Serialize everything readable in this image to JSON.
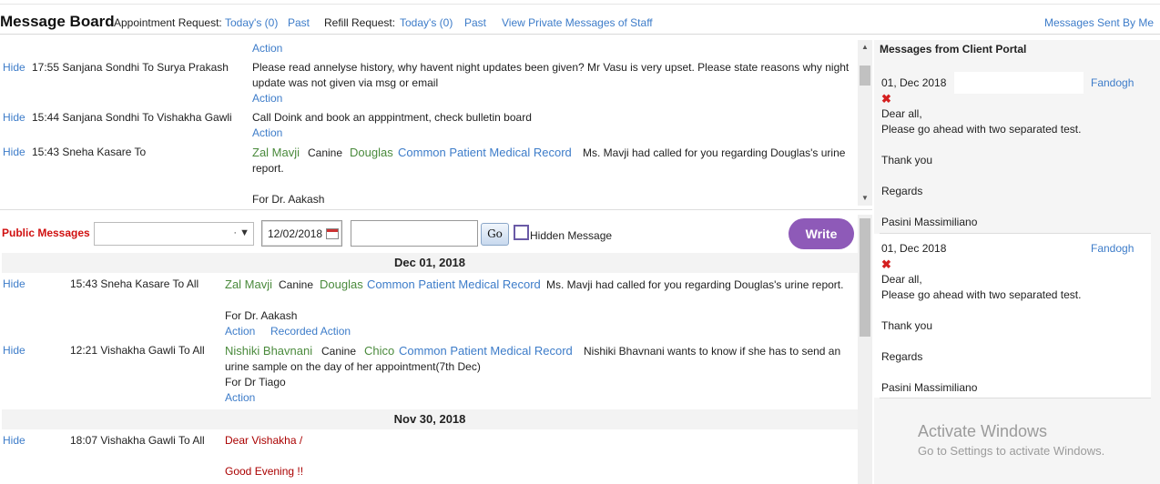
{
  "header": {
    "title": "Message Board",
    "appt_label": "Appointment Request:",
    "appt_today": "Today's (0)",
    "appt_past": "Past",
    "refill_label": "Refill Request:",
    "refill_today": "Today's (0)",
    "refill_past": "Past",
    "view_private": "View Private Messages of Staff",
    "sent_by_me": "Messages Sent By Me"
  },
  "private": {
    "top_action": "Action",
    "rows": [
      {
        "hide": "Hide",
        "meta": "17:55 Sanjana Sondhi To Surya Prakash",
        "line1": "Please read annelyse history, why havent night updates been given? Mr Vasu is very upset. Please state reasons why night",
        "line2": "update was not given via msg or email",
        "action": "Action"
      },
      {
        "hide": "Hide",
        "meta": "15:44 Sanjana Sondhi To Vishakha Gawli",
        "line1": "Call Doink and book an apppintment, check bulletin board",
        "action": "Action"
      },
      {
        "hide": "Hide",
        "meta": "15:43 Sneha Kasare To",
        "client": "Zal Mavji",
        "species": "Canine",
        "patient": "Douglas",
        "record": "Common Patient Medical Record",
        "line1": "Ms. Mavji had called for you regarding Douglas's urine",
        "line2": "report.",
        "line3": "For Dr. Aakash"
      }
    ]
  },
  "public_bar": {
    "label": "Public Messages",
    "select_value": "",
    "date_value": "12/02/2018",
    "search_value": "",
    "go": "Go",
    "hidden_label": "Hidden Message",
    "write": "Write"
  },
  "public": {
    "groups": [
      {
        "date": "Dec 01, 2018",
        "rows": [
          {
            "hide": "Hide",
            "meta": "15:43 Sneha Kasare To All",
            "client": "Zal Mavji",
            "species": "Canine",
            "patient": "Douglas",
            "record": "Common Patient Medical Record",
            "line1": "Ms. Mavji had called for you regarding Douglas's urine report.",
            "line3": "For Dr. Aakash",
            "action": "Action",
            "recorded": "Recorded Action"
          },
          {
            "hide": "Hide",
            "meta": "12:21 Vishakha Gawli To All",
            "client": "Nishiki Bhavnani",
            "species": "Canine",
            "patient": "Chico",
            "record": "Common Patient Medical Record",
            "line1": "Nishiki Bhavnani wants to know if she has to send an",
            "line2": "urine sample on the day of her appointment(7th Dec)",
            "line3": "For Dr Tiago",
            "action": "Action"
          }
        ]
      },
      {
        "date": "Nov 30, 2018",
        "rows": [
          {
            "hide": "Hide",
            "meta": "18:07 Vishakha Gawli To All",
            "line1": "Dear Vishakha /",
            "line2": "Good Evening !!"
          }
        ]
      }
    ]
  },
  "portal": {
    "title": "Messages from Client Portal",
    "cards": [
      {
        "date": "01, Dec 2018",
        "from": "Fandogh",
        "delete": "✖",
        "lines": [
          "Dear all,",
          "Please go ahead with two separated test.",
          "",
          "Thank you",
          "",
          "Regards",
          "",
          "Pasini Massimiliano"
        ]
      },
      {
        "date": "01, Dec 2018",
        "from": "Fandogh",
        "delete": "✖",
        "lines": [
          "Dear all,",
          "Please go ahead with two separated test.",
          "",
          "Thank you",
          "",
          "Regards",
          "",
          "Pasini Massimiliano"
        ]
      }
    ]
  },
  "os_notice": {
    "line1": "Activate Windows",
    "line2": "Go to Settings to activate Windows."
  }
}
